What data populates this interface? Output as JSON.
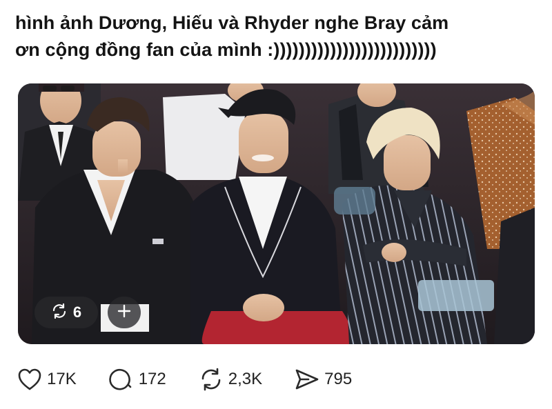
{
  "post": {
    "text_line_1": "hình ảnh Dương, Hiếu và Rhyder nghe Bray cảm",
    "text_line_2": "ơn cộng đồng fan của mình :))))))))))))))))))))))))))"
  },
  "media": {
    "repost_count": "6",
    "icons": [
      "repost-icon",
      "plus-icon"
    ]
  },
  "actions": {
    "likes": "17K",
    "replies": "172",
    "reposts": "2,3K",
    "shares": "795",
    "icons": [
      "heart-icon",
      "reply-icon",
      "repost-icon",
      "share-icon"
    ]
  },
  "colors": {
    "text": "#141414",
    "icon": "#2a2a2a",
    "overlay": "#28282c"
  }
}
